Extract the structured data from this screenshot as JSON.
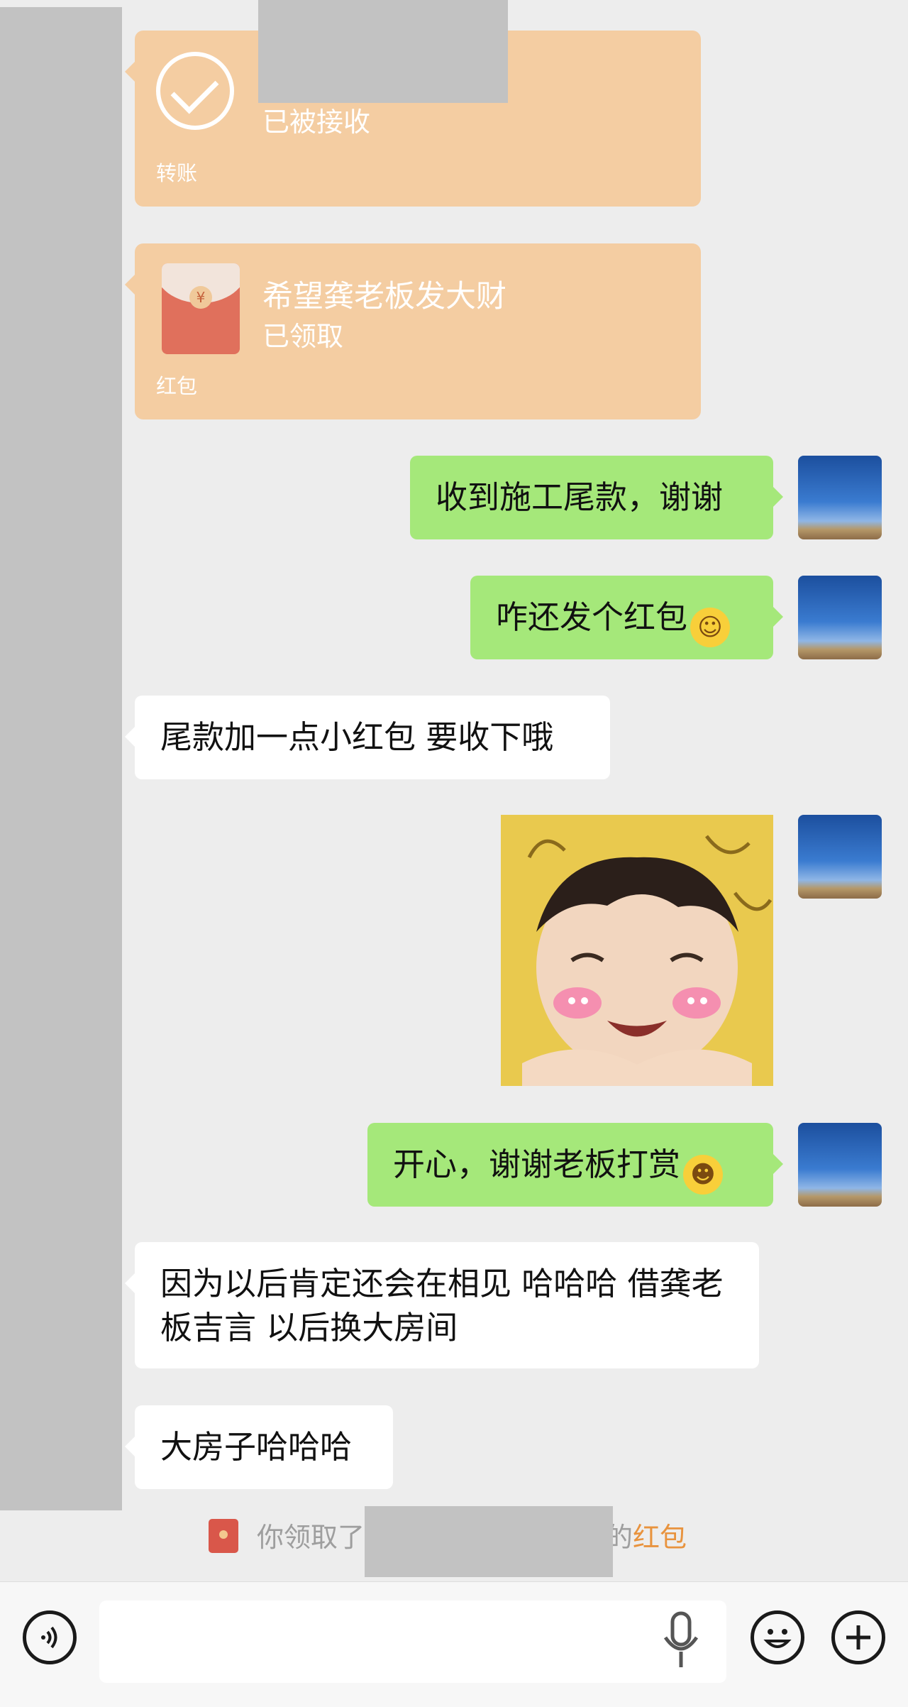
{
  "transfer_card": {
    "status": "已被接收",
    "type_label": "转账"
  },
  "red_packet_card": {
    "title": "希望龚老板发大财",
    "status": "已领取",
    "type_label": "红包"
  },
  "messages": [
    {
      "sender": "me",
      "text": "收到施工尾款，谢谢"
    },
    {
      "sender": "me",
      "text": "咋还发个红包",
      "emoji": "rolling-laughing-emoji"
    },
    {
      "sender": "them",
      "text": "尾款加一点小红包 要收下哦"
    },
    {
      "sender": "me",
      "type": "sticker",
      "sticker": "smiling-child-sticker"
    },
    {
      "sender": "me",
      "text": "开心，谢谢老板打赏",
      "emoji": "grinning-emoji"
    },
    {
      "sender": "them",
      "text": "因为以后肯定还会在相见 哈哈哈 借龚老板吉言 以后换大房间"
    },
    {
      "sender": "them",
      "text": "大房子哈哈哈"
    }
  ],
  "system_notice": {
    "prefix": "你领取了",
    "suffix": "的",
    "highlight": "红包",
    "highlight_color": "#e8933e"
  },
  "input_bar": {
    "value": "",
    "icons": [
      "voice-toggle-icon",
      "microphone-icon",
      "emoji-icon",
      "plus-icon"
    ]
  },
  "colors": {
    "background": "#ededed",
    "my_bubble": "#a5e87a",
    "their_bubble": "#ffffff",
    "card": "#f4cda2"
  }
}
